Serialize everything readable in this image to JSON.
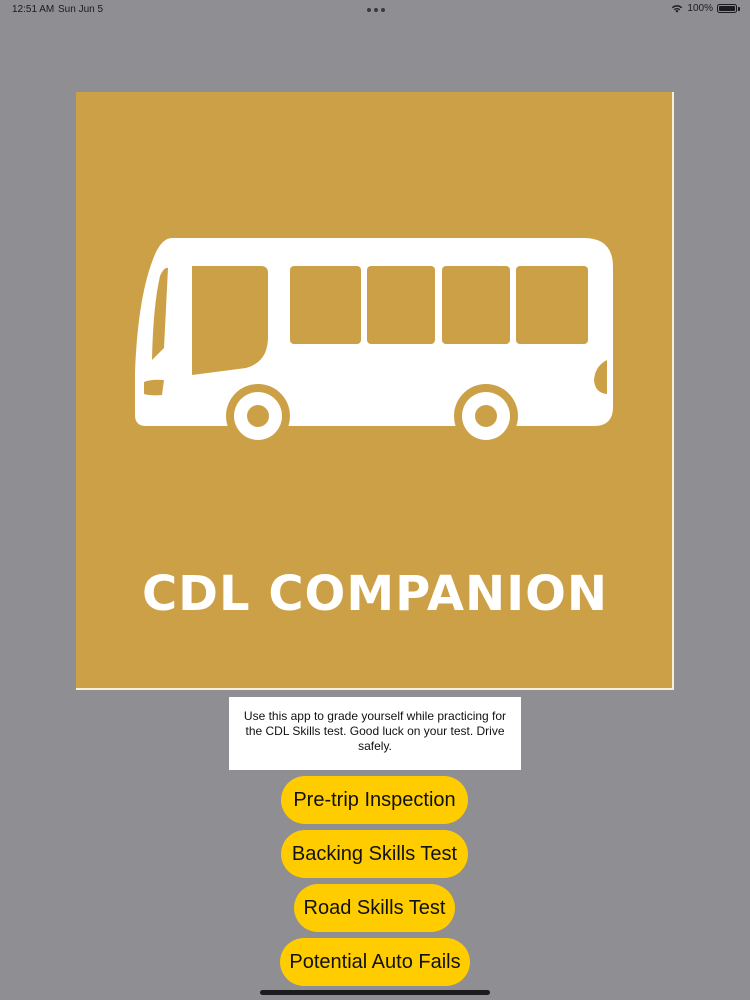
{
  "status_bar": {
    "time": "12:51 AM",
    "date": "Sun Jun 5",
    "battery": "100%"
  },
  "logo": {
    "title": "CDL COMPANION",
    "background_color": "#cca047",
    "icon": "bus-icon"
  },
  "description": {
    "text": "Use this app to grade yourself while practicing for the CDL Skills test. Good luck on your test. Drive safely."
  },
  "menu": {
    "pretrip_label": "Pre-trip Inspection",
    "backing_label": "Backing Skills Test",
    "road_label": "Road Skills Test",
    "autofail_label": "Potential Auto Fails",
    "button_color": "#ffcc00"
  }
}
